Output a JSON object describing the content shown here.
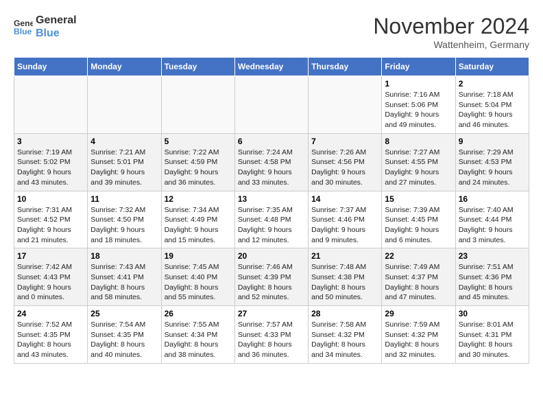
{
  "logo": {
    "line1": "General",
    "line2": "Blue"
  },
  "title": "November 2024",
  "subtitle": "Wattenheim, Germany",
  "days_header": [
    "Sunday",
    "Monday",
    "Tuesday",
    "Wednesday",
    "Thursday",
    "Friday",
    "Saturday"
  ],
  "weeks": [
    [
      {
        "day": "",
        "info": ""
      },
      {
        "day": "",
        "info": ""
      },
      {
        "day": "",
        "info": ""
      },
      {
        "day": "",
        "info": ""
      },
      {
        "day": "",
        "info": ""
      },
      {
        "day": "1",
        "info": "Sunrise: 7:16 AM\nSunset: 5:06 PM\nDaylight: 9 hours and 49 minutes."
      },
      {
        "day": "2",
        "info": "Sunrise: 7:18 AM\nSunset: 5:04 PM\nDaylight: 9 hours and 46 minutes."
      }
    ],
    [
      {
        "day": "3",
        "info": "Sunrise: 7:19 AM\nSunset: 5:02 PM\nDaylight: 9 hours and 43 minutes."
      },
      {
        "day": "4",
        "info": "Sunrise: 7:21 AM\nSunset: 5:01 PM\nDaylight: 9 hours and 39 minutes."
      },
      {
        "day": "5",
        "info": "Sunrise: 7:22 AM\nSunset: 4:59 PM\nDaylight: 9 hours and 36 minutes."
      },
      {
        "day": "6",
        "info": "Sunrise: 7:24 AM\nSunset: 4:58 PM\nDaylight: 9 hours and 33 minutes."
      },
      {
        "day": "7",
        "info": "Sunrise: 7:26 AM\nSunset: 4:56 PM\nDaylight: 9 hours and 30 minutes."
      },
      {
        "day": "8",
        "info": "Sunrise: 7:27 AM\nSunset: 4:55 PM\nDaylight: 9 hours and 27 minutes."
      },
      {
        "day": "9",
        "info": "Sunrise: 7:29 AM\nSunset: 4:53 PM\nDaylight: 9 hours and 24 minutes."
      }
    ],
    [
      {
        "day": "10",
        "info": "Sunrise: 7:31 AM\nSunset: 4:52 PM\nDaylight: 9 hours and 21 minutes."
      },
      {
        "day": "11",
        "info": "Sunrise: 7:32 AM\nSunset: 4:50 PM\nDaylight: 9 hours and 18 minutes."
      },
      {
        "day": "12",
        "info": "Sunrise: 7:34 AM\nSunset: 4:49 PM\nDaylight: 9 hours and 15 minutes."
      },
      {
        "day": "13",
        "info": "Sunrise: 7:35 AM\nSunset: 4:48 PM\nDaylight: 9 hours and 12 minutes."
      },
      {
        "day": "14",
        "info": "Sunrise: 7:37 AM\nSunset: 4:46 PM\nDaylight: 9 hours and 9 minutes."
      },
      {
        "day": "15",
        "info": "Sunrise: 7:39 AM\nSunset: 4:45 PM\nDaylight: 9 hours and 6 minutes."
      },
      {
        "day": "16",
        "info": "Sunrise: 7:40 AM\nSunset: 4:44 PM\nDaylight: 9 hours and 3 minutes."
      }
    ],
    [
      {
        "day": "17",
        "info": "Sunrise: 7:42 AM\nSunset: 4:43 PM\nDaylight: 9 hours and 0 minutes."
      },
      {
        "day": "18",
        "info": "Sunrise: 7:43 AM\nSunset: 4:41 PM\nDaylight: 8 hours and 58 minutes."
      },
      {
        "day": "19",
        "info": "Sunrise: 7:45 AM\nSunset: 4:40 PM\nDaylight: 8 hours and 55 minutes."
      },
      {
        "day": "20",
        "info": "Sunrise: 7:46 AM\nSunset: 4:39 PM\nDaylight: 8 hours and 52 minutes."
      },
      {
        "day": "21",
        "info": "Sunrise: 7:48 AM\nSunset: 4:38 PM\nDaylight: 8 hours and 50 minutes."
      },
      {
        "day": "22",
        "info": "Sunrise: 7:49 AM\nSunset: 4:37 PM\nDaylight: 8 hours and 47 minutes."
      },
      {
        "day": "23",
        "info": "Sunrise: 7:51 AM\nSunset: 4:36 PM\nDaylight: 8 hours and 45 minutes."
      }
    ],
    [
      {
        "day": "24",
        "info": "Sunrise: 7:52 AM\nSunset: 4:35 PM\nDaylight: 8 hours and 43 minutes."
      },
      {
        "day": "25",
        "info": "Sunrise: 7:54 AM\nSunset: 4:35 PM\nDaylight: 8 hours and 40 minutes."
      },
      {
        "day": "26",
        "info": "Sunrise: 7:55 AM\nSunset: 4:34 PM\nDaylight: 8 hours and 38 minutes."
      },
      {
        "day": "27",
        "info": "Sunrise: 7:57 AM\nSunset: 4:33 PM\nDaylight: 8 hours and 36 minutes."
      },
      {
        "day": "28",
        "info": "Sunrise: 7:58 AM\nSunset: 4:32 PM\nDaylight: 8 hours and 34 minutes."
      },
      {
        "day": "29",
        "info": "Sunrise: 7:59 AM\nSunset: 4:32 PM\nDaylight: 8 hours and 32 minutes."
      },
      {
        "day": "30",
        "info": "Sunrise: 8:01 AM\nSunset: 4:31 PM\nDaylight: 8 hours and 30 minutes."
      }
    ]
  ]
}
